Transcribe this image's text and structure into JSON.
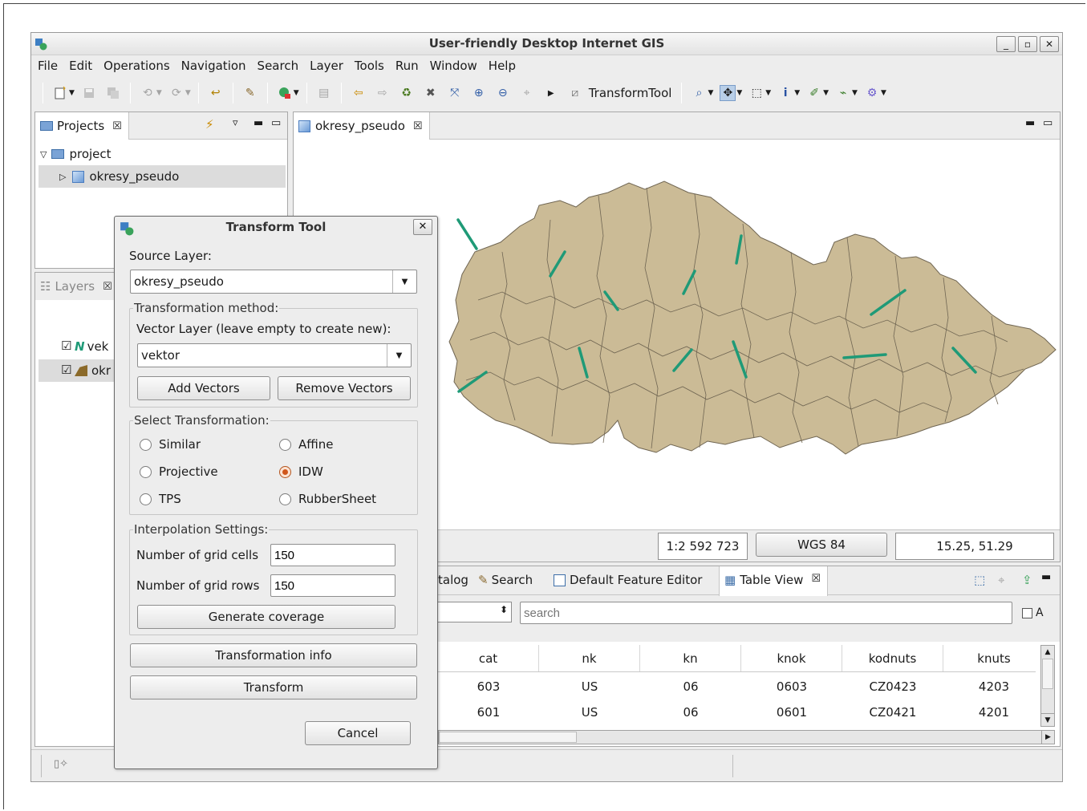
{
  "window": {
    "title": "User-friendly Desktop Internet GIS",
    "controls": [
      "_",
      "▫",
      "✕"
    ]
  },
  "menu": [
    {
      "label": "File"
    },
    {
      "label": "Edit"
    },
    {
      "label": "Operations"
    },
    {
      "label": "Navigation"
    },
    {
      "label": "Search"
    },
    {
      "label": "Layer"
    },
    {
      "label": "Tools"
    },
    {
      "label": "Run"
    },
    {
      "label": "Window"
    },
    {
      "label": "Help"
    }
  ],
  "toolbar": {
    "transform_tool_label": "TransformTool",
    "info_icon": "i"
  },
  "projects_panel": {
    "tab_label": "Projects",
    "close": "☒",
    "tree": {
      "root": "project",
      "child": "okresy_pseudo"
    }
  },
  "layers_panel": {
    "tab_label": "Layers",
    "close": "☒",
    "items": [
      {
        "label": "vek",
        "checked": "☑"
      },
      {
        "label": "okr",
        "checked": "☑"
      }
    ]
  },
  "map_editor": {
    "tab_label": "okresy_pseudo",
    "close": "☒",
    "scale": "1:2 592 723",
    "crs": "WGS 84",
    "coords": "15.25, 51.29",
    "map_colors": {
      "fill": "#cbbb96",
      "stroke": "#6f6552",
      "vector": "#1f9a77"
    }
  },
  "bottom_views": {
    "tabs": [
      {
        "label": "talog"
      },
      {
        "label": "Search"
      },
      {
        "label": "Default Feature Editor"
      },
      {
        "label": "Table View",
        "close": "☒"
      }
    ],
    "search_placeholder": "search",
    "checkbox_label": "A",
    "columns": [
      "cat",
      "nk",
      "kn",
      "knok",
      "kodnuts",
      "knuts"
    ],
    "rows": [
      [
        "603",
        "US",
        "06",
        "0603",
        "CZ0423",
        "4203"
      ],
      [
        "601",
        "US",
        "06",
        "0601",
        "CZ0421",
        "4201"
      ]
    ]
  },
  "dialog": {
    "title": "Transform Tool",
    "close": "✕",
    "source_layer_label": "Source Layer:",
    "source_layer_value": "okresy_pseudo",
    "transformation_method_legend": "Transformation method:",
    "vector_layer_label": "Vector Layer (leave empty to create new):",
    "vector_layer_value": "vektor",
    "add_vectors": "Add Vectors",
    "remove_vectors": "Remove Vectors",
    "select_transformation_legend": "Select Transformation:",
    "options": [
      {
        "label": "Similar",
        "selected": false
      },
      {
        "label": "Affine",
        "selected": false
      },
      {
        "label": "Projective",
        "selected": false
      },
      {
        "label": "IDW",
        "selected": true
      },
      {
        "label": "TPS",
        "selected": false
      },
      {
        "label": "RubberSheet",
        "selected": false
      }
    ],
    "interpolation_legend": "Interpolation Settings:",
    "grid_cells_label": "Number of grid cells",
    "grid_cells_value": "150",
    "grid_rows_label": "Number of grid rows",
    "grid_rows_value": "150",
    "generate_coverage": "Generate coverage",
    "transformation_info": "Transformation info",
    "transform": "Transform",
    "cancel": "Cancel"
  }
}
